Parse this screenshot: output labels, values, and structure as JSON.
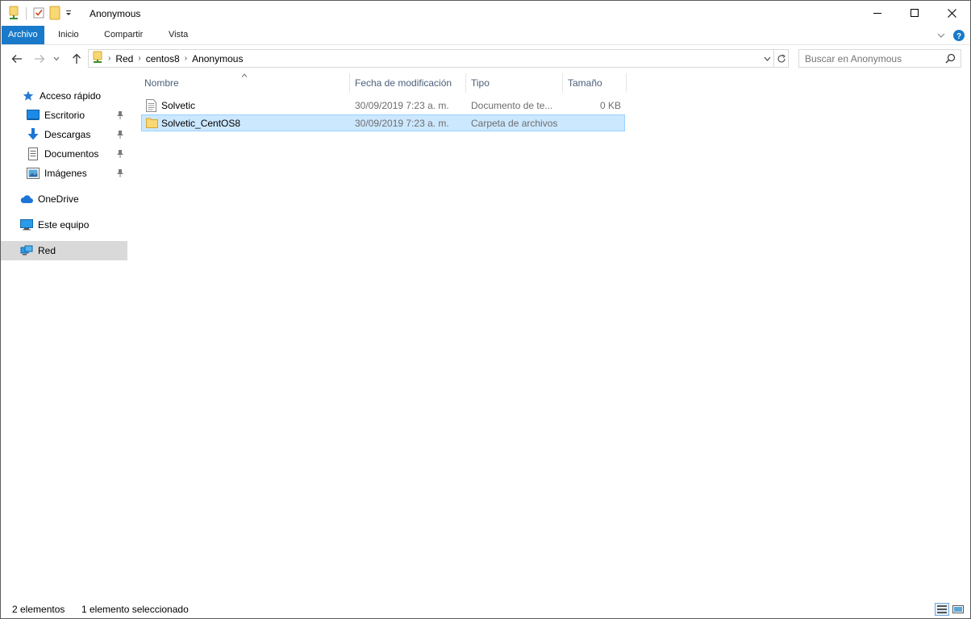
{
  "window": {
    "title": "Anonymous"
  },
  "ribbon": {
    "tabs": [
      {
        "label": "Archivo",
        "active": true
      },
      {
        "label": "Inicio"
      },
      {
        "label": "Compartir"
      },
      {
        "label": "Vista"
      }
    ]
  },
  "address": {
    "crumbs": [
      "Red",
      "centos8",
      "Anonymous"
    ]
  },
  "search": {
    "placeholder": "Buscar en Anonymous"
  },
  "nav_pane": {
    "quick_access": {
      "label": "Acceso rápido",
      "items": [
        {
          "label": "Escritorio",
          "icon": "desktop-icon",
          "pinned": true
        },
        {
          "label": "Descargas",
          "icon": "download-icon",
          "pinned": true
        },
        {
          "label": "Documentos",
          "icon": "documents-icon",
          "pinned": true
        },
        {
          "label": "Imágenes",
          "icon": "pictures-icon",
          "pinned": true
        }
      ]
    },
    "onedrive": "OneDrive",
    "this_pc": "Este equipo",
    "network": "Red"
  },
  "columns": {
    "name": "Nombre",
    "modified": "Fecha de modificación",
    "type": "Tipo",
    "size": "Tamaño"
  },
  "files": [
    {
      "name": "Solvetic",
      "modified": "30/09/2019 7:23 a. m.",
      "type": "Documento de te...",
      "size": "0 KB",
      "icon": "text-file-icon",
      "selected": false
    },
    {
      "name": "Solvetic_CentOS8",
      "modified": "30/09/2019 7:23 a. m.",
      "type": "Carpeta de archivos",
      "size": "",
      "icon": "folder-icon",
      "selected": true
    }
  ],
  "status": {
    "count": "2 elementos",
    "selection": "1 elemento seleccionado"
  },
  "colors": {
    "accent": "#1979ca",
    "selection_bg": "#cce8ff",
    "selection_border": "#99d1ff",
    "nav_selected": "#d9d9d9",
    "header_text": "#4c607a"
  }
}
